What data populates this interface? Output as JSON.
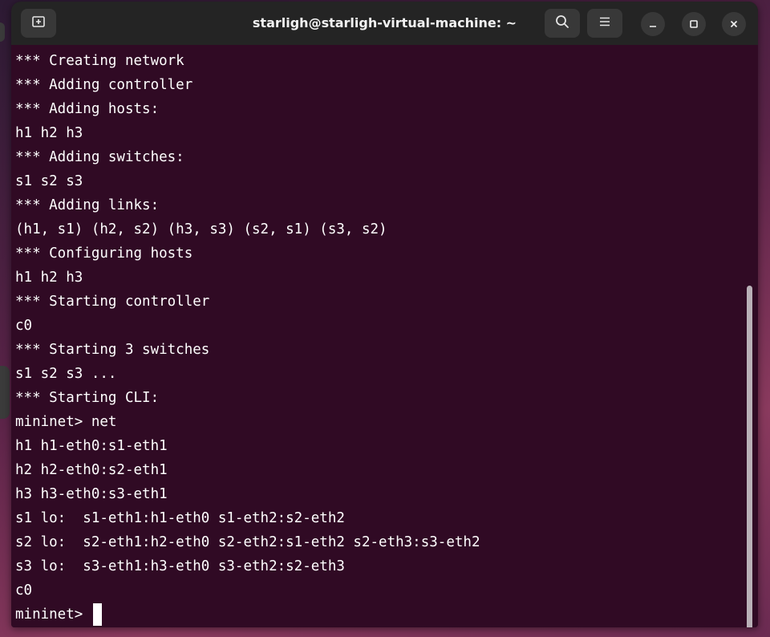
{
  "window": {
    "title": "starligh@starligh-virtual-machine: ~"
  },
  "icons": {
    "new_tab": "new-tab-icon",
    "search": "search-icon",
    "menu": "hamburger-menu-icon",
    "minimize": "minimize-icon",
    "maximize": "maximize-icon",
    "close": "close-icon"
  },
  "colors": {
    "terminal_bg": "#300a24",
    "titlebar_bg": "#242424",
    "text": "#ffffff"
  },
  "terminal": {
    "lines": [
      "*** Creating network",
      "*** Adding controller",
      "*** Adding hosts:",
      "h1 h2 h3",
      "*** Adding switches:",
      "s1 s2 s3",
      "*** Adding links:",
      "(h1, s1) (h2, s2) (h3, s3) (s2, s1) (s3, s2)",
      "*** Configuring hosts",
      "h1 h2 h3",
      "*** Starting controller",
      "c0",
      "*** Starting 3 switches",
      "s1 s2 s3 ...",
      "*** Starting CLI:",
      "mininet> net",
      "h1 h1-eth0:s1-eth1",
      "h2 h2-eth0:s2-eth1",
      "h3 h3-eth0:s3-eth1",
      "s1 lo:  s1-eth1:h1-eth0 s1-eth2:s2-eth2",
      "s2 lo:  s2-eth1:h2-eth0 s2-eth2:s1-eth2 s2-eth3:s3-eth2",
      "s3 lo:  s3-eth1:h3-eth0 s3-eth2:s2-eth3",
      "c0"
    ],
    "prompt": "mininet> "
  }
}
